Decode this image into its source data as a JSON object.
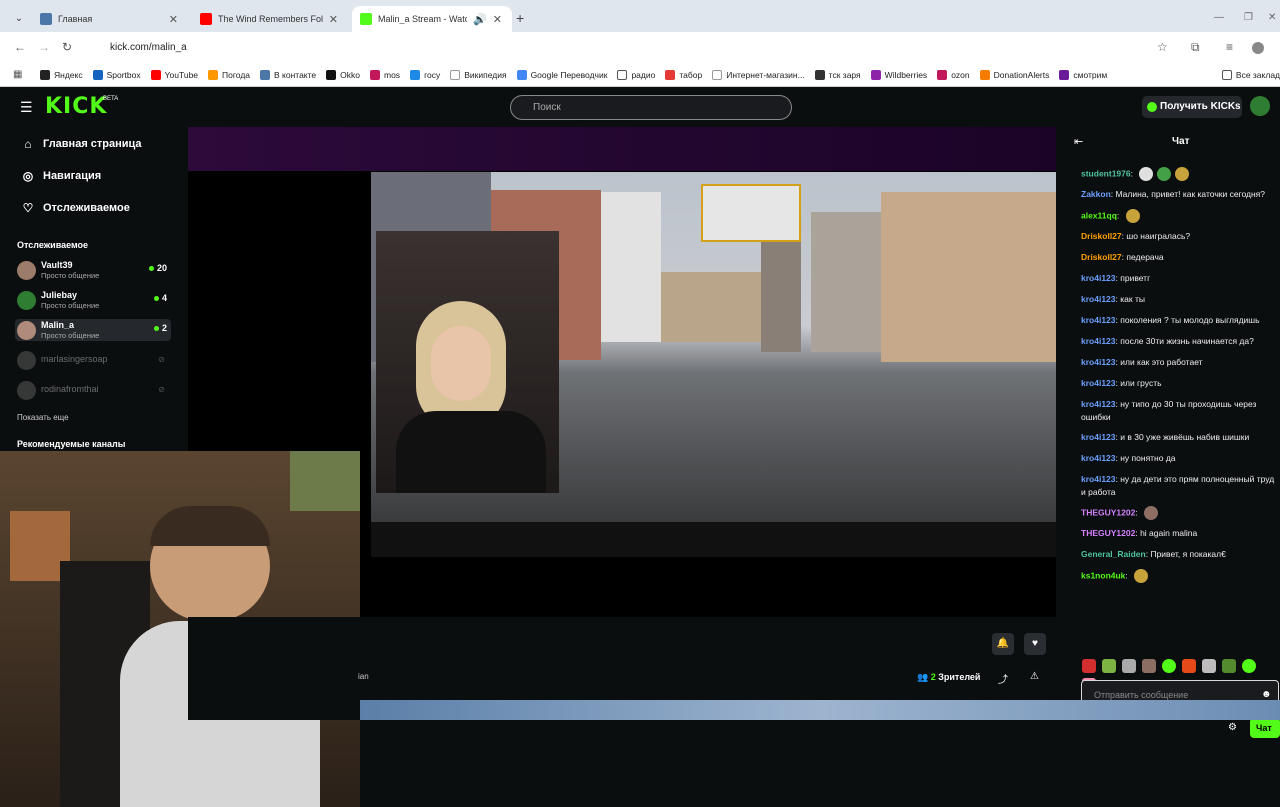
{
  "browser": {
    "tabs": [
      {
        "title": "Главная",
        "color": "#4a76a8"
      },
      {
        "title": "The Wind Remembers Folktron",
        "color": "#ff0000"
      },
      {
        "title": "Malin_a Stream - Watch Liv",
        "color": "#53fc18"
      }
    ],
    "url": "kick.com/malin_a",
    "bookmarks": [
      "Яндекс",
      "Sportbox",
      "YouTube",
      "Погода",
      "В контакте",
      "Okko",
      "mos",
      "госу",
      "Википедия",
      "Google Переводчик",
      "радио",
      "табор",
      "Интернет-магазин...",
      "тск заря",
      "Wildberries",
      "ozon",
      "DonationAlerts",
      "смотрим"
    ],
    "bookmarks_right": "Все заклад"
  },
  "header": {
    "logo": "KICK",
    "beta": "BETA",
    "search_placeholder": "Поиск",
    "kicks_button": "Получить KICKs"
  },
  "sidebar": {
    "nav": [
      {
        "label": "Главная страница",
        "icon": "home-icon"
      },
      {
        "label": "Навигация",
        "icon": "compass-icon"
      },
      {
        "label": "Отслеживаемое",
        "icon": "heart-icon"
      }
    ],
    "following_title": "Отслеживаемое",
    "channels": [
      {
        "name": "Vault39",
        "category": "Просто общение",
        "viewers": "20",
        "live": true
      },
      {
        "name": "Juliebay",
        "category": "Просто общение",
        "viewers": "4",
        "live": true
      },
      {
        "name": "Malin_a",
        "category": "Просто общение",
        "viewers": "2",
        "live": true
      },
      {
        "name": "marlasingersoap",
        "live": false
      },
      {
        "name": "rodinafromthai",
        "live": false
      }
    ],
    "show_more": "Показать еще",
    "recommended_title": "Рекомендуемые каналы"
  },
  "player": {
    "viewers_count": "2",
    "viewers_label": "Зрителей",
    "overlay_label": "ian"
  },
  "chat": {
    "title": "Чат",
    "messages": [
      {
        "user": "student1976",
        "text": "",
        "color": "#4fc3a1",
        "emotes": 3
      },
      {
        "user": "Zakkon",
        "text": "Малина, привет! как каточки сегодня?",
        "color": "#6aa0ff"
      },
      {
        "user": "alex11qq",
        "text": "",
        "color": "#53fc18",
        "emotes": 1
      },
      {
        "user": "Driskoll27",
        "text": "шо наигралась?",
        "color": "#ffa000"
      },
      {
        "user": "Driskoll27",
        "text": "педерача",
        "color": "#ffa000"
      },
      {
        "user": "kro4i123",
        "text": "приветг",
        "color": "#6aa0ff"
      },
      {
        "user": "kro4i123",
        "text": "как ты",
        "color": "#6aa0ff"
      },
      {
        "user": "kro4i123",
        "text": "поколения ? ты молодо выглядишь",
        "color": "#6aa0ff"
      },
      {
        "user": "kro4i123",
        "text": "после 30ти жизнь начинается да?",
        "color": "#6aa0ff"
      },
      {
        "user": "kro4i123",
        "text": "или как это работает",
        "color": "#6aa0ff"
      },
      {
        "user": "kro4i123",
        "text": "или грусть",
        "color": "#6aa0ff"
      },
      {
        "user": "kro4i123",
        "text": "ну типо до 30 ты проходишь через ошибки",
        "color": "#6aa0ff"
      },
      {
        "user": "kro4i123",
        "text": "и в 30 уже живёшь набив шишки",
        "color": "#6aa0ff"
      },
      {
        "user": "kro4i123",
        "text": "ну понятно да",
        "color": "#6aa0ff"
      },
      {
        "user": "kro4i123",
        "text": "ну да дети это прям полноценный труд и работа",
        "color": "#6aa0ff"
      },
      {
        "user": "THEGUY1202",
        "text": "",
        "color": "#d580ff",
        "emotes": 1
      },
      {
        "user": "THEGUY1202",
        "text": "hi again malina",
        "color": "#d580ff"
      },
      {
        "user": "General_Raiden",
        "text": "Привет, я покакал€",
        "color": "#4fc3a1"
      },
      {
        "user": "ks1non4uk",
        "text": "",
        "color": "#53fc18",
        "emotes": 1
      }
    ],
    "input_placeholder": "Отправить сообщение",
    "send_label": "Чат"
  }
}
